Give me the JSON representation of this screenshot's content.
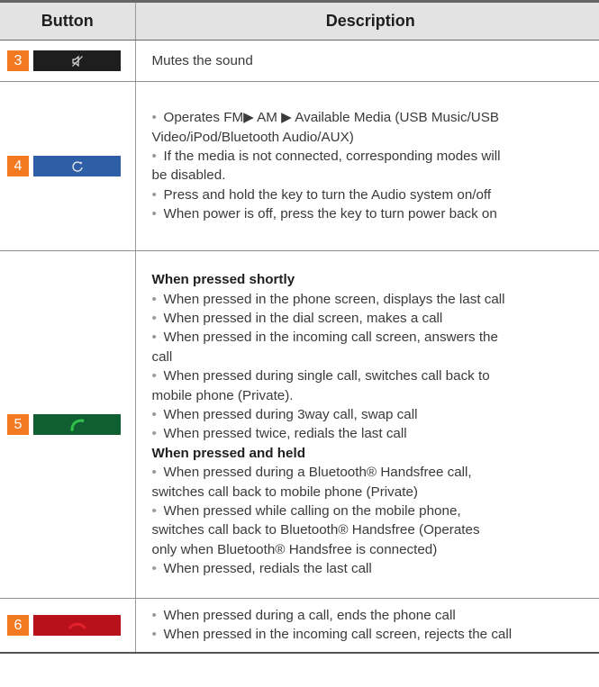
{
  "headers": {
    "button": "Button",
    "description": "Description"
  },
  "rows": [
    {
      "number": "3",
      "icon": "mute-icon",
      "lines": [
        {
          "text": "Mutes the sound",
          "bullet": false
        }
      ]
    },
    {
      "number": "4",
      "icon": "media-cycle-icon",
      "lines": [
        {
          "text": "Operates FM▶ AM ▶ Available Media (USB Music/USB",
          "bullet": true
        },
        {
          "text": "Video/iPod/Bluetooth Audio/AUX)",
          "bullet": false
        },
        {
          "text": "If the media is not connected, corresponding modes will",
          "bullet": true
        },
        {
          "text": "be disabled.",
          "bullet": false
        },
        {
          "text": "Press and hold the key to turn the Audio system on/off",
          "bullet": true
        },
        {
          "text": "When power is off, press the key to turn power back on",
          "bullet": true
        }
      ]
    },
    {
      "number": "5",
      "icon": "call-icon",
      "heading1": "When pressed shortly",
      "lines1": [
        {
          "text": "When pressed in the phone screen, displays the last call",
          "bullet": true
        },
        {
          "text": "When pressed in the dial screen, makes a call",
          "bullet": true
        },
        {
          "text": "When pressed in the incoming call screen, answers the",
          "bullet": true
        },
        {
          "text": "call",
          "bullet": false
        },
        {
          "text": "When pressed during single call, switches call back to",
          "bullet": true
        },
        {
          "text": "mobile phone (Private).",
          "bullet": false
        },
        {
          "text": "When pressed during 3way call, swap call",
          "bullet": true
        },
        {
          "text": "When pressed twice, redials the last call",
          "bullet": true
        }
      ],
      "heading2": "When pressed and held",
      "lines2": [
        {
          "text": "When pressed during a Bluetooth® Handsfree call,",
          "bullet": true
        },
        {
          "text": "switches call back to mobile phone (Private)",
          "bullet": false
        },
        {
          "text": "When pressed while calling on the mobile phone,",
          "bullet": true
        },
        {
          "text": "switches call back to Bluetooth® Handsfree (Operates",
          "bullet": false
        },
        {
          "text": "only when Bluetooth® Handsfree is connected)",
          "bullet": false
        },
        {
          "text": "When pressed, redials the last call",
          "bullet": true
        }
      ]
    },
    {
      "number": "6",
      "icon": "end-call-icon",
      "lines": [
        {
          "text": "When pressed during a call, ends the phone call",
          "bullet": true
        },
        {
          "text": "When pressed in the incoming call screen, rejects the call",
          "bullet": true
        }
      ]
    }
  ],
  "colors": {
    "number_badge": "#f37a21",
    "header_bg": "#e3e3e3",
    "call_green": "#2fbf4a",
    "end_call_red": "#e0202a"
  }
}
